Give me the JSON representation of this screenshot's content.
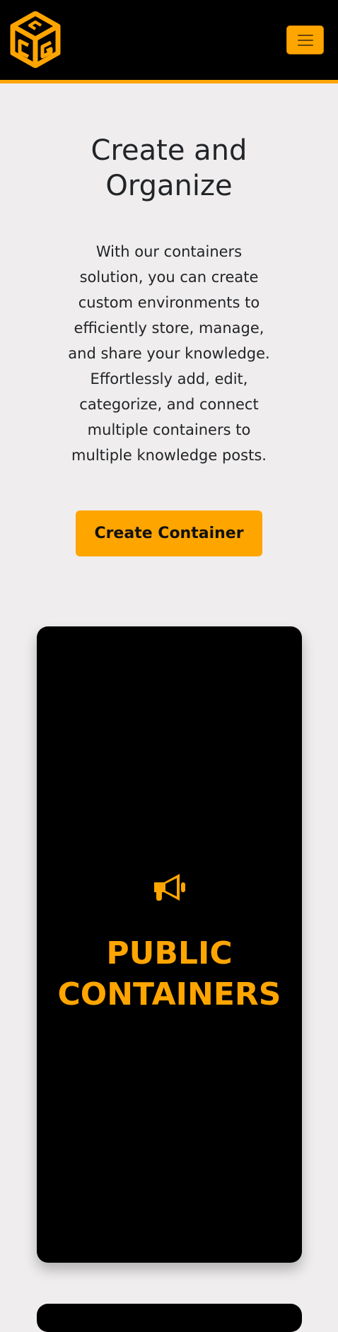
{
  "header": {
    "logo_name": "cube-logo-icon",
    "menu_icon": "hamburger-menu-icon",
    "accent_color": "#ffa500"
  },
  "hero": {
    "title_lines": [
      "Create and",
      "Organize"
    ],
    "description_lines": [
      "With our containers",
      "solution, you can create",
      "custom environments to",
      "efficiently store, manage,",
      "and share your knowledge.",
      "Effortlessly add, edit,",
      "categorize, and connect",
      "multiple containers to",
      "multiple knowledge posts."
    ],
    "cta_label": "Create Container"
  },
  "cards": [
    {
      "icon": "megaphone-icon",
      "title_lines": [
        "PUBLIC",
        "CONTAINERS"
      ]
    }
  ]
}
